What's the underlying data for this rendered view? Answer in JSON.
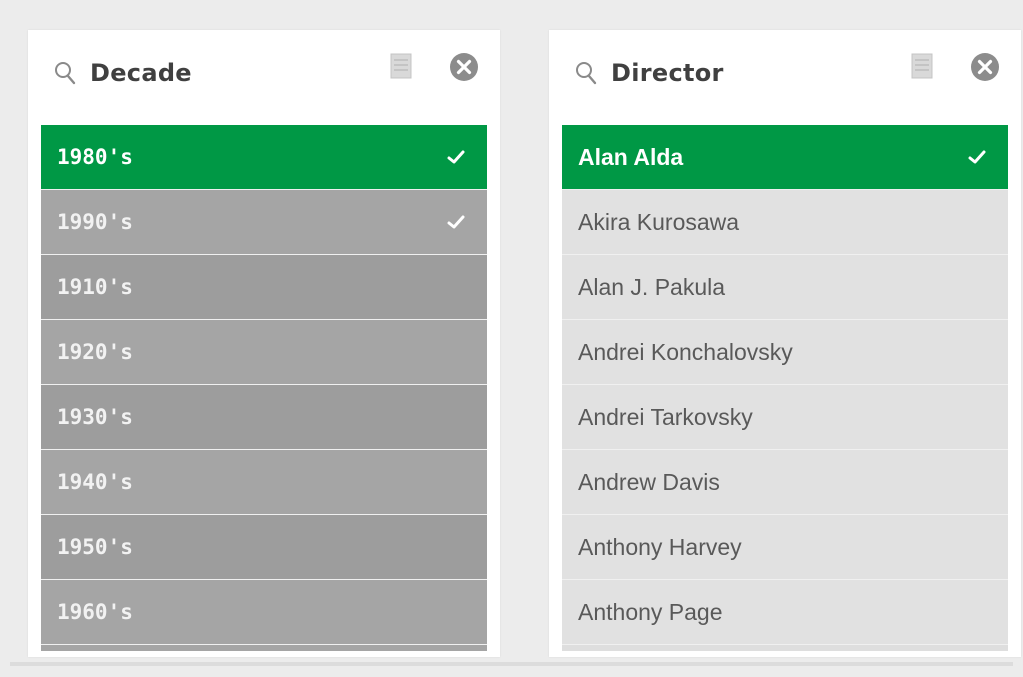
{
  "decade_panel": {
    "title": "Decade",
    "items": [
      {
        "label": "1980's",
        "state": "selected"
      },
      {
        "label": "1990's",
        "state": "excluded-checked"
      },
      {
        "label": "1910's",
        "state": "excluded"
      },
      {
        "label": "1920's",
        "state": "excluded"
      },
      {
        "label": "1930's",
        "state": "excluded"
      },
      {
        "label": "1940's",
        "state": "excluded"
      },
      {
        "label": "1950's",
        "state": "excluded"
      },
      {
        "label": "1960's",
        "state": "excluded"
      }
    ]
  },
  "director_panel": {
    "title": "Director",
    "items": [
      {
        "label": "Alan Alda",
        "state": "selected"
      },
      {
        "label": "Akira Kurosawa",
        "state": "alternative"
      },
      {
        "label": "Alan J. Pakula",
        "state": "alternative"
      },
      {
        "label": "Andrei Konchalovsky",
        "state": "alternative"
      },
      {
        "label": "Andrei Tarkovsky",
        "state": "alternative"
      },
      {
        "label": "Andrew Davis",
        "state": "alternative"
      },
      {
        "label": "Anthony Harvey",
        "state": "alternative"
      },
      {
        "label": "Anthony Page",
        "state": "alternative"
      }
    ]
  },
  "colors": {
    "selected_green": "#009845",
    "excluded_gray": "#a5a5a5",
    "alternative_light_gray": "#e1e1e1"
  },
  "icons": [
    "search-icon",
    "selection-doc-icon",
    "clear-selection-icon",
    "checkmark-icon"
  ]
}
